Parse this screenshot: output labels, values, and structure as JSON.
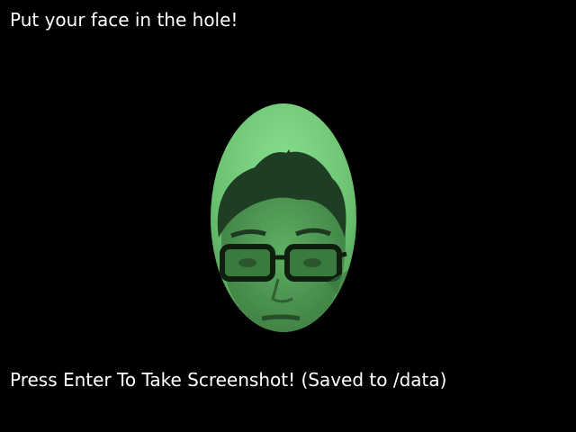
{
  "app": {
    "background_color": "#000000",
    "text_color": "#ffffff"
  },
  "prompt": {
    "text": "Put your face in the hole!"
  },
  "camera": {
    "feed_tint": "#6fcf7a",
    "mask_shape": "ellipse",
    "icon": "webcam-face-feed"
  },
  "instruction": {
    "text": "Press Enter To Take Screenshot! (Saved to /data)"
  }
}
